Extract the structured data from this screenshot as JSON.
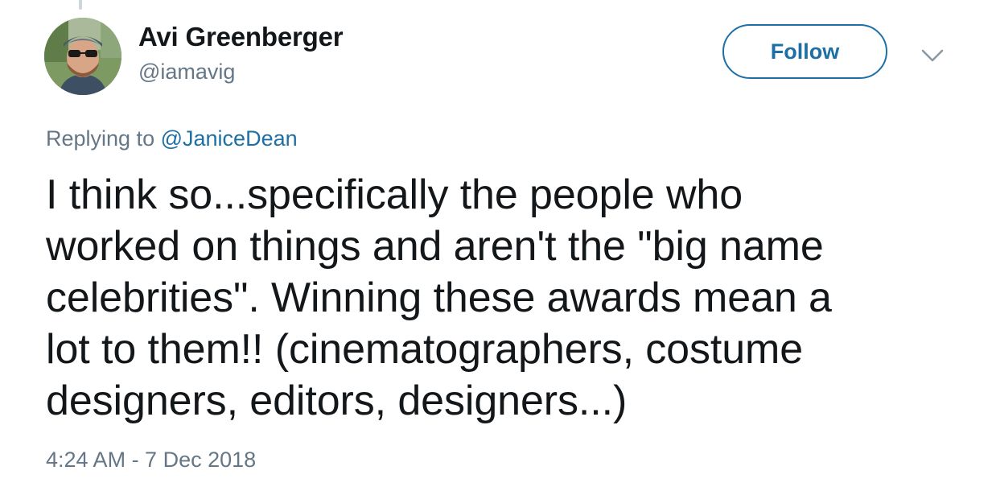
{
  "author": {
    "display_name": "Avi Greenberger",
    "handle": "@iamavig"
  },
  "follow_button": {
    "label": "Follow"
  },
  "menu": {
    "icon": "chevron-down-icon"
  },
  "reply_context": {
    "prefix": "Replying to",
    "mention": "@JaniceDean"
  },
  "tweet": {
    "lines": [
      "I think so...specifically the people who",
      "worked on things and aren't the \"big name",
      "celebrities\". Winning these awards mean a",
      "lot to them!! (cinematographers, costume",
      "designers, editors, designers...)"
    ],
    "timestamp": "4:24 AM - 7 Dec 2018"
  },
  "colors": {
    "text": "#14171a",
    "secondary": "#657786",
    "accent": "#1d6fa5",
    "thread_line": "#ccd6dd"
  }
}
